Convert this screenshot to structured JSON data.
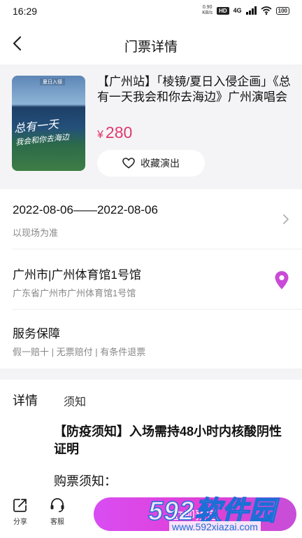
{
  "status_bar": {
    "time": "16:29",
    "speed_value": "0.90",
    "speed_unit": "KB/s",
    "hd": "HD",
    "network": "4G",
    "battery": "100"
  },
  "header": {
    "title": "门票详情"
  },
  "product": {
    "poster_tag": "夏日入侵",
    "poster_text_line1": "总有一天",
    "poster_text_line2": "我会和你去海边",
    "title": "【广州站】「棱镜/夏日入侵企画」《总有一天我会和你去海边》广州演唱会",
    "price_symbol": "¥",
    "price": "280",
    "favorite_label": "收藏演出"
  },
  "date_info": {
    "range": "2022-08-06——2022-08-06",
    "note": "以现场为准"
  },
  "venue": {
    "name": "广州市|广州体育馆1号馆",
    "address": "广东省广州市广州体育馆1号馆"
  },
  "service": {
    "title": "服务保障",
    "items": "假一赔十 | 无票赔付 | 有条件退票"
  },
  "detail_tabs": {
    "detail": "详情",
    "notice": "须知"
  },
  "notice": {
    "heading": "【防疫须知】入场需持48小时内核酸阴性证明",
    "purchase_label": "购票须知："
  },
  "bottom_bar": {
    "share_label": "分享",
    "service_label": "客服",
    "buy_label": "立即预定"
  },
  "watermark": {
    "brand": "592软件园",
    "url": "www.592xiazai.com"
  },
  "colors": {
    "accent": "#e2386c",
    "buy_gradient_start": "#d84df2",
    "buy_gradient_end": "#c64fd8",
    "pin": "#c94ad6"
  }
}
